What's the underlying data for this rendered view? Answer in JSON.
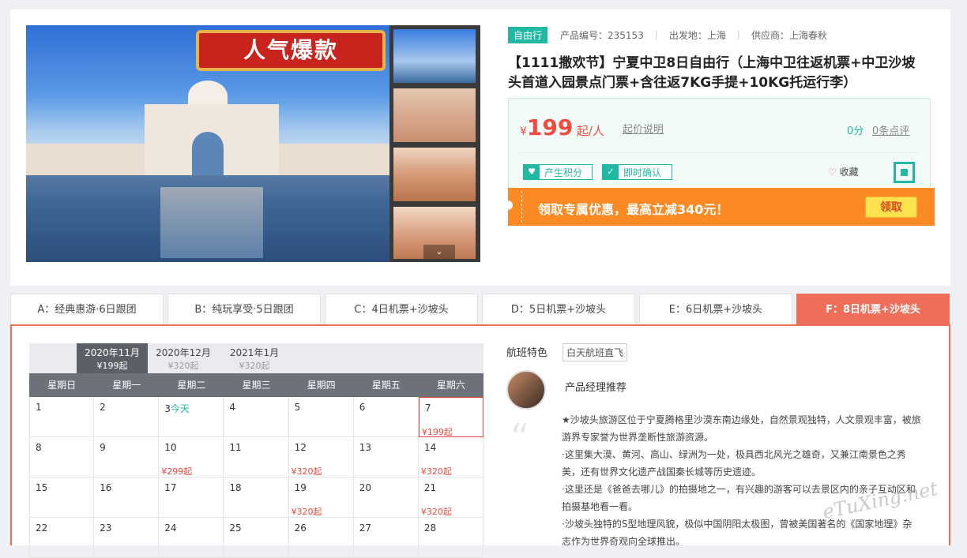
{
  "gallery": {
    "banner_text": "人气爆款",
    "thumb_down_icon": "⌄"
  },
  "product": {
    "tag": "自由行",
    "meta": [
      "产品编号：235153",
      "出发地：上海",
      "供应商：上海春秋"
    ],
    "title": "【1111撒欢节】宁夏中卫8日自由行（上海中卫往返机票+中卫沙坡头首道入园景点门票+含往返7KG手提+10KG托运行李）"
  },
  "price": {
    "currency": "¥",
    "amount": "199",
    "unit": "起/人",
    "note": "起价说明",
    "score": "0分",
    "reviews": "0条点评",
    "badges": [
      "产生积分",
      "即时确认"
    ],
    "favorite": "收藏"
  },
  "coupon": {
    "text": "领取专属优惠，最高立减340元！",
    "button": "领取"
  },
  "tabs": [
    "A：经典惠游·6日跟团",
    "B：纯玩享受·5日跟团",
    "C：4日机票+沙坡头",
    "D：5日机票+沙坡头",
    "E：6日机票+沙坡头",
    "F：8日机票+沙坡头"
  ],
  "calendar": {
    "months": [
      {
        "label": "2020年11月",
        "price": "¥199起"
      },
      {
        "label": "2020年12月",
        "price": "¥320起"
      },
      {
        "label": "2021年1月",
        "price": "¥320起"
      }
    ],
    "weekdays": [
      "星期日",
      "星期一",
      "星期二",
      "星期三",
      "星期四",
      "星期五",
      "星期六"
    ],
    "days": [
      {
        "d": "1",
        "p": ""
      },
      {
        "d": "2",
        "p": ""
      },
      {
        "d": "3",
        "t": "今天",
        "p": ""
      },
      {
        "d": "4",
        "p": ""
      },
      {
        "d": "5",
        "p": ""
      },
      {
        "d": "6",
        "p": ""
      },
      {
        "d": "7",
        "p": "¥199起"
      },
      {
        "d": "8",
        "p": ""
      },
      {
        "d": "9",
        "p": ""
      },
      {
        "d": "10",
        "p": "¥299起"
      },
      {
        "d": "11",
        "p": ""
      },
      {
        "d": "12",
        "p": "¥320起"
      },
      {
        "d": "13",
        "p": ""
      },
      {
        "d": "14",
        "p": "¥320起"
      },
      {
        "d": "15",
        "p": ""
      },
      {
        "d": "16",
        "p": ""
      },
      {
        "d": "17",
        "p": ""
      },
      {
        "d": "18",
        "p": ""
      },
      {
        "d": "19",
        "p": "¥320起"
      },
      {
        "d": "20",
        "p": ""
      },
      {
        "d": "21",
        "p": "¥320起"
      },
      {
        "d": "22",
        "p": ""
      },
      {
        "d": "23",
        "p": ""
      },
      {
        "d": "24",
        "p": ""
      },
      {
        "d": "25",
        "p": ""
      },
      {
        "d": "26",
        "p": ""
      },
      {
        "d": "27",
        "p": ""
      },
      {
        "d": "28",
        "p": ""
      }
    ]
  },
  "flight": {
    "label": "航班特色",
    "badge": "白天航班直飞"
  },
  "manager": {
    "label": "产品经理推荐",
    "paragraphs": [
      "★沙坡头旅游区位于宁夏腾格里沙漠东南边缘处，自然景观独特，人文景观丰富，被旅游界专家誉为世界垄断性旅游资源。",
      "·这里集大漠、黄河、高山、绿洲为一处，极具西北风光之雄奇，又兼江南景色之秀美，还有世界文化遗产战国秦长城等历史遗迹。",
      "·这里还是《爸爸去哪儿》的拍摄地之一，有兴趣的游客可以去景区内的亲子互动区和拍摄基地看一看。",
      "·沙坡头独特的S型地理风貌，极似中国阴阳太极图，曾被美国著名的《国家地理》杂志作为世界奇观向全球推出。"
    ]
  },
  "watermark": "eTuXing.net"
}
